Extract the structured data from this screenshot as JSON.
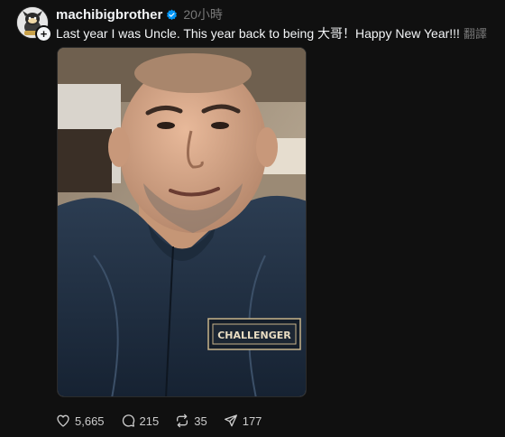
{
  "post": {
    "username": "machibigbrother",
    "timestamp": "20小時",
    "text": "Last year I was Uncle. This year back to being 大哥！Happy New Year!!!",
    "translate_label": "翻譯",
    "media_badge_text": "CHALLENGER"
  },
  "actions": {
    "likes": "5,665",
    "replies": "215",
    "reposts": "35",
    "shares": "177"
  },
  "icons": {
    "verified": "verified-badge-icon",
    "follow": "plus-icon",
    "like": "heart-icon",
    "reply": "comment-bubble-icon",
    "repost": "repost-icon",
    "share": "send-icon"
  },
  "colors": {
    "background": "#101010",
    "text": "#f3f5f7",
    "muted": "#777777",
    "verified": "#0095f6"
  }
}
